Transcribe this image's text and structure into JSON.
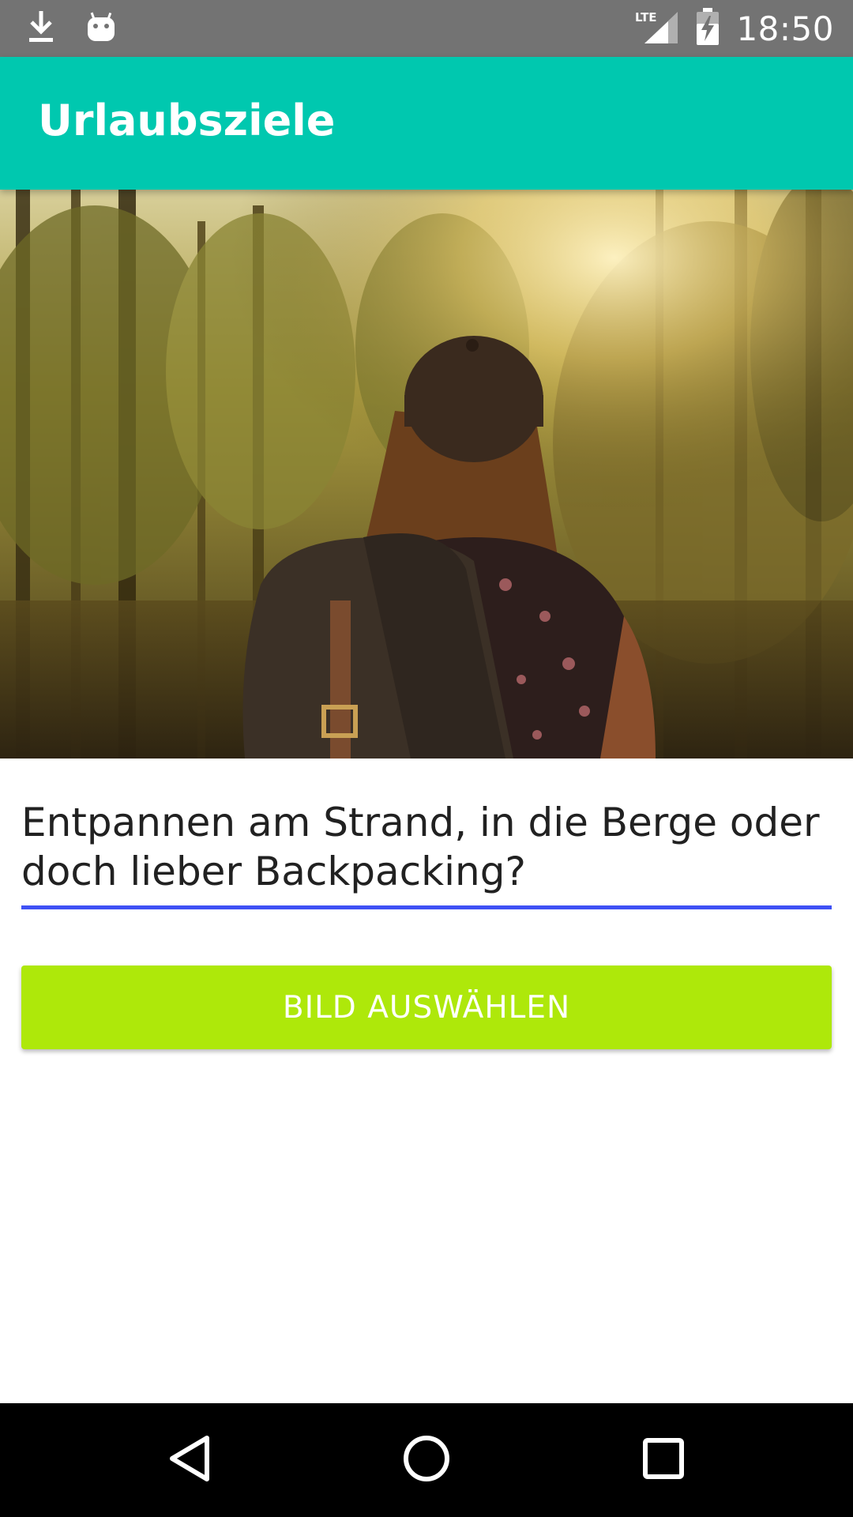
{
  "status_bar": {
    "time": "18:50",
    "icons": [
      "download-icon",
      "android-debug-icon",
      "lte-signal-icon",
      "battery-charging-icon"
    ],
    "network_label": "LTE"
  },
  "app_bar": {
    "title": "Urlaubsziele",
    "color": "#00c8af"
  },
  "hero": {
    "image_alt_icon": "hiker-forest-image"
  },
  "text_field": {
    "value": "Entpannen am Strand, in die Berge oder doch lieber Backpacking?",
    "underline_color": "#3f51f5"
  },
  "button": {
    "label": "BILD AUSWÄHLEN",
    "color": "#aee80a"
  },
  "nav_bar": {
    "items": [
      "back-icon",
      "home-icon",
      "recents-icon"
    ]
  }
}
